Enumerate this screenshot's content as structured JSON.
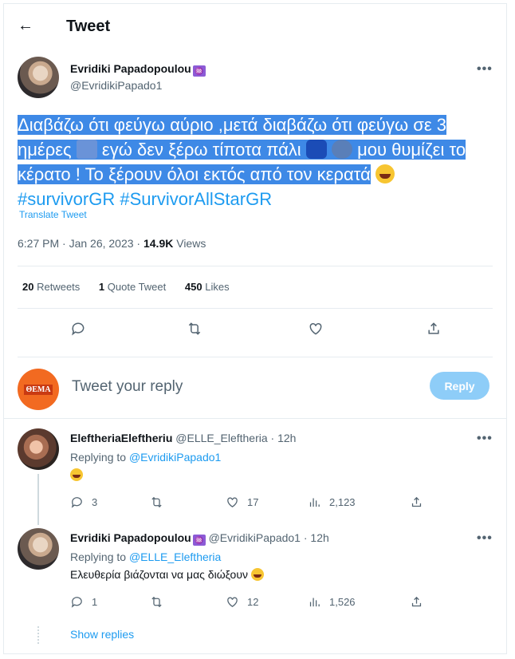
{
  "header": {
    "back_icon": "←",
    "title": "Tweet"
  },
  "tweet": {
    "author_name": "Evridiki Papadopoulou",
    "author_badge": "♒",
    "author_handle": "@EvridikiPapado1",
    "more_label": "•••",
    "text_part1": "Διαβάζω ότι φεύγω αύριο ,μετά διαβάζω ότι φεύγω σε 3 ημέρες",
    "text_part2": "εγώ δεν ξέρω τίποτα πάλι",
    "text_part3": "μου θυμίζει το κέρατο ! Το ξέρουν όλοι εκτός από τον κερατά",
    "hashtag1": "#survivorGR",
    "hashtag2": "#SurvivorAllStarGR",
    "translate_label": "Translate Tweet",
    "time": "6:27 PM · Jan 26, 2023 · ",
    "views_count": "14.9K",
    "views_label": " Views",
    "retweets_count": "20",
    "retweets_label": "Retweets",
    "quote_count": "1",
    "quote_label": "Quote Tweet",
    "likes_count": "450",
    "likes_label": "Likes",
    "highlight_color": "#3e89e6"
  },
  "composer": {
    "logo_text": "ΘΕΜΑ",
    "placeholder": "Tweet your reply",
    "reply_button": "Reply",
    "reply_button_color": "#8ecdf8"
  },
  "replies": [
    {
      "name": "EleftheriaEleftheriu",
      "handle_time": "@ELLE_Eleftheria · 12h",
      "replying_prefix": "Replying to ",
      "replying_to": "@EvridikiPapado1",
      "text": "",
      "replies": "3",
      "retweets": "",
      "likes": "17",
      "views": "2,123"
    },
    {
      "name": "Evridiki Papadopoulou",
      "badge": "♒",
      "handle_time": "@EvridikiPapado1 · 12h",
      "replying_prefix": "Replying to ",
      "replying_to": "@ELLE_Eleftheria",
      "text": "Ελευθερία βιάζονται να μας διώξουν",
      "replies": "1",
      "retweets": "",
      "likes": "12",
      "views": "1,526"
    }
  ],
  "show_replies": "Show replies",
  "accent_color": "#1d9bf0"
}
